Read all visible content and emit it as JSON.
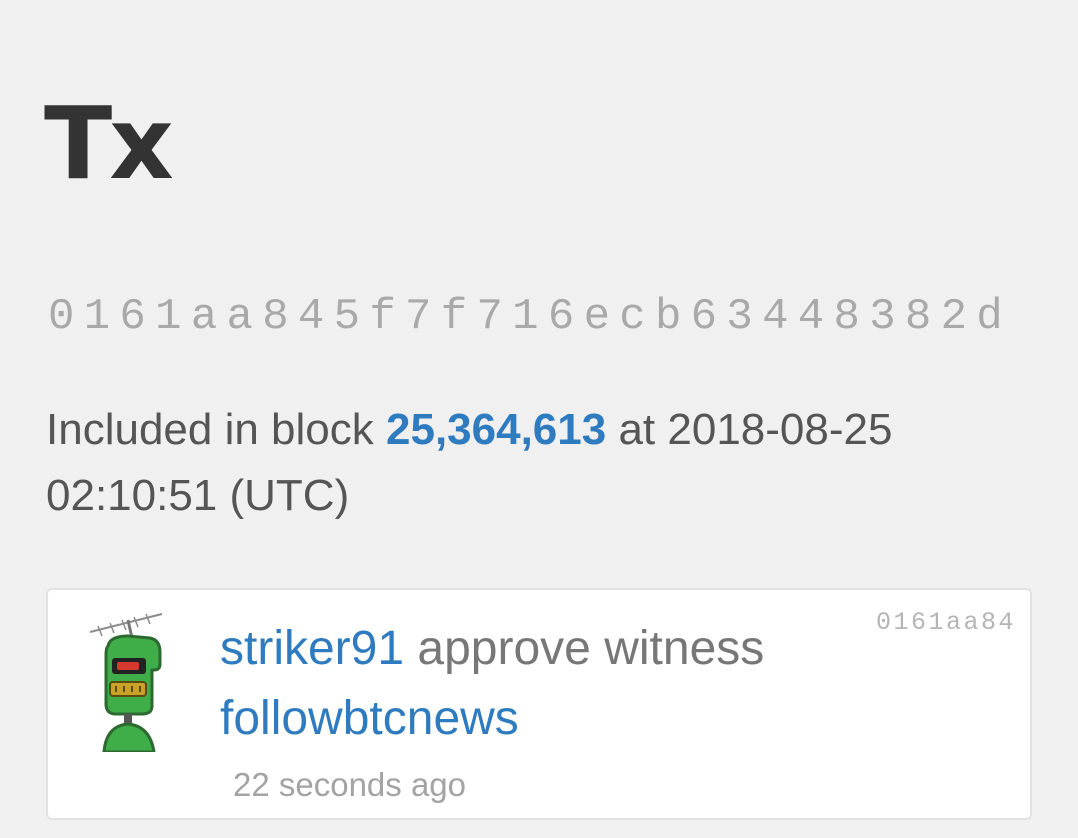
{
  "page": {
    "title": "Tx"
  },
  "transaction": {
    "hash": "0161aa845f7f716ecb63448382d",
    "included_in_block_label": "Included in block",
    "block_number": "25,364,613",
    "at_label": "at",
    "timestamp": "2018-08-25 02:10:51 (UTC)"
  },
  "operation": {
    "short_id": "0161aa84",
    "account": "striker91",
    "action": "approve witness",
    "witness": "followbtcnews",
    "time_ago": "22 seconds ago"
  },
  "colors": {
    "link": "#2f7bbf",
    "background": "#f0f0f0",
    "avatar_green": "#3fae49"
  },
  "icons": {
    "avatar": "robot-avatar-icon"
  }
}
